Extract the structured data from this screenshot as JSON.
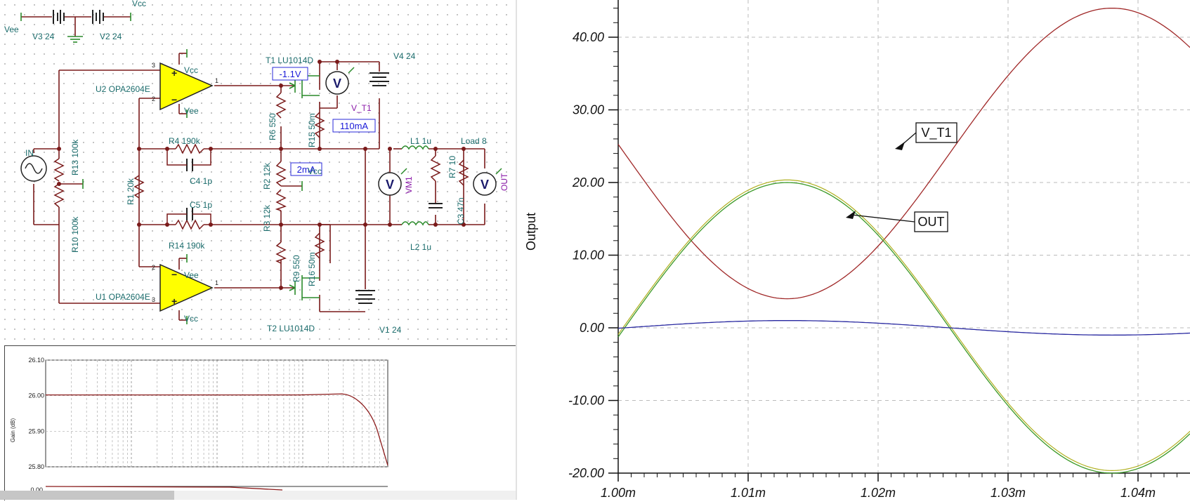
{
  "schematic": {
    "labels": {
      "vcc_top": "Vcc",
      "vee_top": "Vee",
      "v3": "V3 24",
      "v2": "V2 24",
      "u2": "U2 OPA2604E",
      "u1": "U1 OPA2604E",
      "u2_vcc": "Vcc",
      "u2_vee": "Vee",
      "u1_vee": "Vee",
      "u1_vcc": "Vcc",
      "pin3_top": "3",
      "pin2_top": "2",
      "pin1_top": "1",
      "pin2_bot": "2",
      "pin3_bot": "3",
      "pin1_bot": "1",
      "t1": "T1 LU1014D",
      "t2": "T2 LU1014D",
      "v4": "V4 24",
      "v1": "V1 24",
      "v_t1": "V_T1",
      "vm1": "VM1",
      "out": "OUT",
      "in": "IN",
      "load": "Load 8",
      "l1": "L1 1u",
      "l2": "L2 1u",
      "r7": "R7 10",
      "c3": "C3 47n",
      "r15": "R15 50m",
      "r16": "R16 50m",
      "r6": "R6 550",
      "r9": "R9 550",
      "r2": "R2 12k",
      "r3": "R3 12k",
      "r4": "R4 190k",
      "r14": "R14 190k",
      "c4": "C4 1p",
      "c5": "C5 1p",
      "r1": "R1 20k",
      "r13": "R13 100k",
      "r10": "R10 100k",
      "vcc_mid": "Vcc",
      "meter_v": "V",
      "plus": "+",
      "minus": "−"
    },
    "readouts": {
      "gate_voltage": "-1.1V",
      "drain_current": "110mA",
      "bias_current": "2mA"
    }
  },
  "bode": {
    "y_label": "Gain (dB)",
    "y_ticks": [
      "26.10",
      "26.00",
      "25.90",
      "25.80"
    ],
    "phase_tick": "0.00",
    "curve_color": "#8b1a1a"
  },
  "scope": {
    "y_label": "Output",
    "y_ticks": [
      "40.00",
      "30.00",
      "20.00",
      "10.00",
      "0.00",
      "-10.00",
      "-20.00"
    ],
    "x_ticks": [
      "1.00m",
      "1.01m",
      "1.02m",
      "1.03m",
      "1.04m"
    ],
    "callouts": {
      "v_t1": "V_T1",
      "out": "OUT"
    },
    "colors": {
      "v_t1": "#a02828",
      "out": "#3c9a28",
      "out2": "#b0b020",
      "small": "#2828a0"
    }
  },
  "chart_data": {
    "type": "line",
    "title": "",
    "xlabel": "",
    "ylabel": "Output",
    "xlim": [
      1.0,
      1.046
    ],
    "ylim": [
      -20,
      45
    ],
    "x_unit": "ms",
    "series": [
      {
        "name": "V_T1",
        "x": [
          1.0,
          1.005,
          1.01,
          1.013,
          1.018,
          1.025,
          1.03,
          1.038,
          1.046
        ],
        "y": [
          24.7,
          12.0,
          5.0,
          4.0,
          8.0,
          22.0,
          33.0,
          44.0,
          35.0
        ]
      },
      {
        "name": "OUT",
        "x": [
          1.0,
          1.005,
          1.013,
          1.02,
          1.025,
          1.03,
          1.038,
          1.046
        ],
        "y": [
          -1.0,
          13.0,
          20.0,
          13.0,
          0.0,
          -12.0,
          -20.0,
          -10.0
        ]
      },
      {
        "x": [
          1.0,
          1.013,
          1.025,
          1.038,
          1.046
        ],
        "y": [
          0.0,
          1.0,
          0.0,
          -1.0,
          -0.5
        ]
      }
    ]
  }
}
